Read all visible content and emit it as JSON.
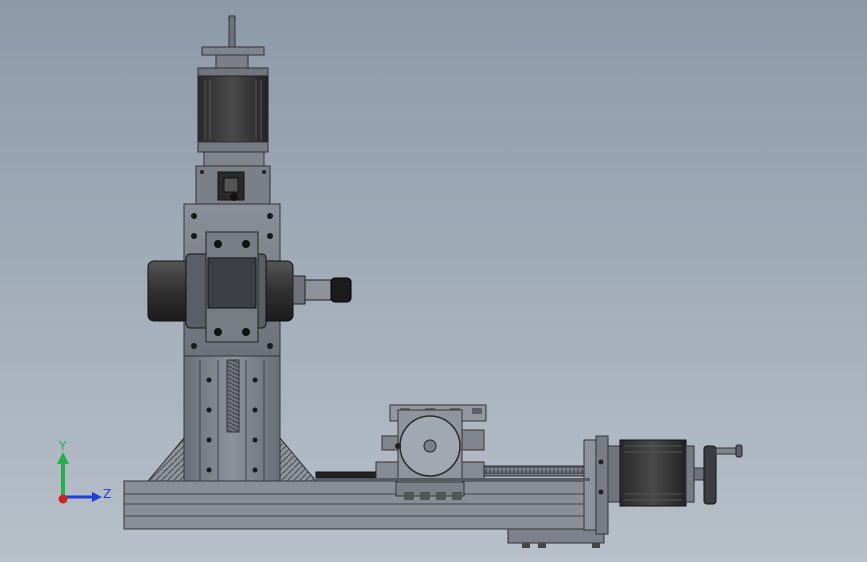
{
  "scene": {
    "background_top": "#8c99a8",
    "background_bottom": "#b8c0c9",
    "parts": [
      "stepper-motor-z",
      "shaft-coupling",
      "z-axis-column",
      "spindle-motor",
      "spindle-collet",
      "base-extrusion-rail",
      "rotary-table",
      "stepper-motor-x",
      "hand-wheel",
      "lead-screw",
      "gear-rack"
    ]
  },
  "triad": {
    "y_label": "Y",
    "z_label": "Z",
    "y_color": "#22b24c",
    "z_color": "#2040d0",
    "x_color": "#d02020"
  }
}
